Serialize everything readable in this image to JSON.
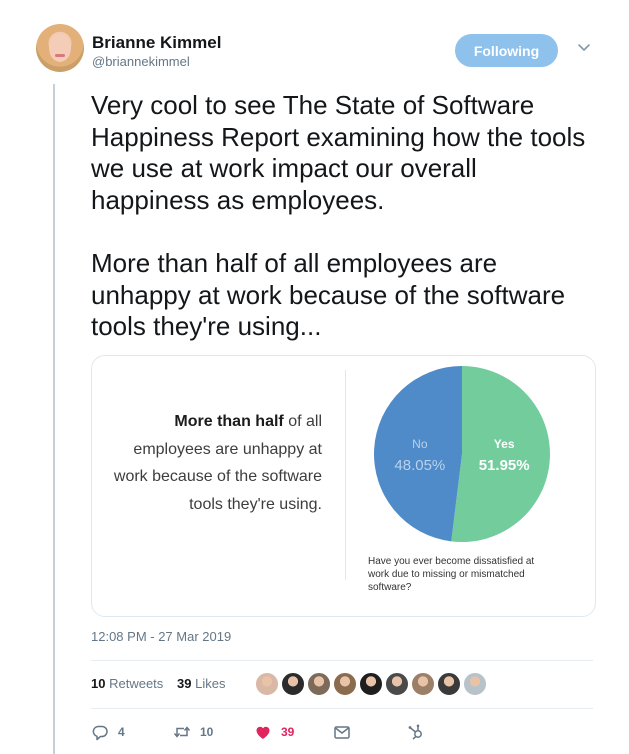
{
  "author": {
    "display_name": "Brianne Kimmel",
    "handle": "@briannekimmel"
  },
  "follow_button_label": "Following",
  "tweet": {
    "paragraphs": [
      "Very cool to see The State of Software Happiness Report examining how the tools we use at work impact our overall happiness as employees.",
      "More than half of all employees are unhappy at work because of the software tools they're using..."
    ]
  },
  "media": {
    "quote_bold": "More than half",
    "quote_rest": " of all employees are unhappy at work because of the software tools they're using.",
    "question": "Have you ever become dissatisfied at work due to missing or mismatched software?"
  },
  "chart_data": {
    "type": "pie",
    "title": "",
    "slices": [
      {
        "label": "No",
        "value": 48.05,
        "value_label": "48.05%",
        "color": "#4f8ac9"
      },
      {
        "label": "Yes",
        "value": 51.95,
        "value_label": "51.95%",
        "color": "#73cc9c"
      }
    ]
  },
  "timestamp": "12:08 PM - 27 Mar 2019",
  "stats": {
    "retweets_count": "10",
    "retweets_label": "Retweets",
    "likes_count": "39",
    "likes_label": "Likes"
  },
  "likers_avatar_colors": [
    "#d9b8a6",
    "#2b2b2b",
    "#7d6a58",
    "#8a6b4e",
    "#1e1e1e",
    "#4a4a4a",
    "#9c7f67",
    "#3a3a3a",
    "#b7c2c9"
  ],
  "actions": {
    "reply_count": "4",
    "retweet_count": "10",
    "like_count": "39"
  },
  "colors": {
    "accent": "#1da1f2",
    "follow_button": "#8ec1ec",
    "like": "#e0245e",
    "secondary_text": "#657786"
  }
}
